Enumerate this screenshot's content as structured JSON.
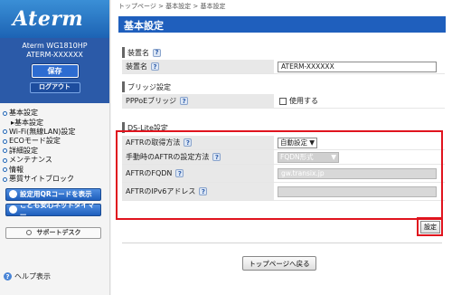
{
  "logo": "Aterm",
  "device": {
    "model": "Aterm WG1810HP",
    "ssid": "ATERM-XXXXXX"
  },
  "sidebar": {
    "save_label": "保存",
    "logout_label": "ログアウト",
    "nav": [
      {
        "label": "基本設定"
      },
      {
        "label": "Wi-Fi(無線LAN)設定"
      },
      {
        "label": "ECOモード設定"
      },
      {
        "label": "詳細設定"
      },
      {
        "label": "メンテナンス"
      },
      {
        "label": "情報"
      },
      {
        "label": "悪質サイトブロック"
      }
    ],
    "nav_sub": "▸基本設定",
    "qr_button": "設定用QRコードを表示",
    "timer_button": "こども安心ネットタイマー",
    "support_button": "サポートデスク",
    "help_label": "ヘルプ表示"
  },
  "breadcrumb": "トップページ > 基本設定 > 基本設定",
  "page_title": "基本設定",
  "sections": {
    "device_name": {
      "heading": "装置名",
      "row_label": "装置名",
      "value": "ATERM-XXXXXX"
    },
    "bridge": {
      "heading": "ブリッジ設定",
      "row_label": "PPPoEブリッジ",
      "checkbox_label": "使用する"
    },
    "dslite": {
      "heading": "DS-Lite設定",
      "rows": [
        {
          "label": "AFTRの取得方法",
          "value": "自動設定"
        },
        {
          "label": "手動時のAFTRの設定方法",
          "value": "FQDN形式"
        },
        {
          "label": "AFTRのFQDN",
          "value": "gw.transix.jp"
        },
        {
          "label": "AFTRのIPv6アドレス",
          "value": ""
        }
      ]
    }
  },
  "buttons": {
    "settei": "設定",
    "back": "トップページへ戻る"
  },
  "colors": {
    "accent": "#1f5fbd",
    "highlight": "#e0141e"
  }
}
